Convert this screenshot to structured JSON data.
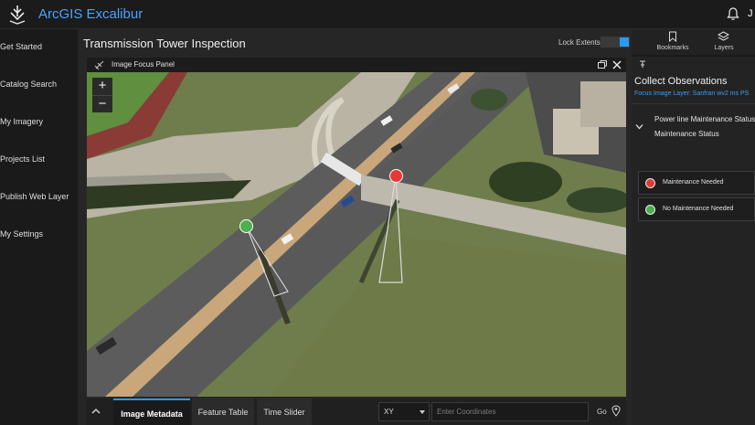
{
  "app": {
    "title": "ArcGIS Excalibur",
    "user_initial": "J"
  },
  "sidebar": {
    "items": [
      {
        "label": "Get Started"
      },
      {
        "label": "Catalog Search"
      },
      {
        "label": "My Imagery"
      },
      {
        "label": "Projects List"
      },
      {
        "label": "Publish Web Layer"
      },
      {
        "label": "My Settings"
      }
    ]
  },
  "project": {
    "title": "Transmission Tower Inspection",
    "lock_extents_label": "Lock Extents",
    "lock_extents_on": true
  },
  "image_panel": {
    "title": "Image Focus Panel"
  },
  "zoom": {
    "in": "+",
    "out": "−"
  },
  "bottom": {
    "tabs": [
      {
        "label": "Image Metadata",
        "active": true
      },
      {
        "label": "Feature Table",
        "active": false
      },
      {
        "label": "Time Slider",
        "active": false
      }
    ],
    "coordinate_system": "XY",
    "coordinate_placeholder": "Enter Coordinates",
    "go_label": "Go"
  },
  "toolbar": {
    "bookmarks_label": "Bookmarks",
    "layers_label": "Layers"
  },
  "observations": {
    "title": "Collect Observations",
    "focus_layer": "Focus Image Layer: Sanfran wv2 ms PS",
    "template_name": "Power line Maintenance Status",
    "field_name": "Maintenance Status",
    "options": [
      {
        "label": "Maintenance Needed",
        "color": "#e53935"
      },
      {
        "label": "No Maintenance Needed",
        "color": "#4caf50"
      }
    ]
  },
  "map_markers": [
    {
      "status": "Maintenance Needed",
      "color": "#e53935"
    },
    {
      "status": "No Maintenance Needed",
      "color": "#4caf50"
    }
  ],
  "colors": {
    "accent": "#2b9af3",
    "brand": "#4aa3ff"
  }
}
